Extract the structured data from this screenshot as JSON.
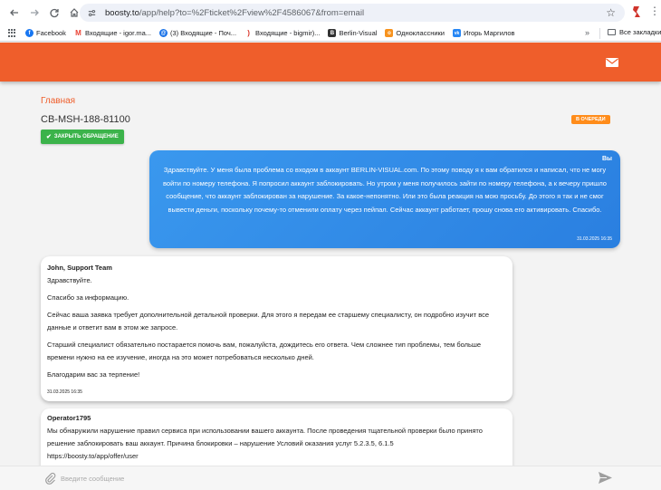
{
  "browser": {
    "url_host": "boosty.to",
    "url_path": "/app/help?to=%2Fticket%2Fview%2F4586067&from=email"
  },
  "bookmarks": {
    "items": [
      {
        "label": "Facebook",
        "color": "#1877f2",
        "glyph": "f"
      },
      {
        "label": "Входящие - igor.ma...",
        "color": "#ea4335",
        "glyph": "M"
      },
      {
        "label": "(3) Входящие - Поч...",
        "color": "#1a73e8",
        "glyph": "@"
      },
      {
        "label": "Входящие - bigmir)...",
        "color": "#d93025",
        "glyph": ")"
      },
      {
        "label": "Berlin-Visual",
        "color": "#333333",
        "glyph": "B"
      },
      {
        "label": "Одноклассники",
        "color": "#f7931e",
        "glyph": "ok"
      },
      {
        "label": "Игорь Маргилов",
        "color": "#2787f5",
        "glyph": "vk"
      }
    ],
    "more": "»",
    "all_label": "Все закладки"
  },
  "page": {
    "home_link": "Главная",
    "ticket_id": "CB-MSH-188-81100",
    "status_badge": "В ОЧЕРЕДИ",
    "close_button": "ЗАКРЫТЬ ОБРАЩЕНИЕ",
    "accent": "#ef5e2b"
  },
  "messages": {
    "user": {
      "author": "Вы",
      "text": "Здравствуйте. У меня была проблема со входом в аккаунт BERLIN-VISUAL.com. По этому поводу я к вам обратился и написал, что не могу войти по номеру телефона. Я попросил аккаунт заблокировать. Но утром у меня получилось зайти по номеру телефона, а к вечеру пришло сообщение, что аккаунт заблокирован за нарушение. За какое-непонятно. Или это была реакция на мою просьбу. До этого я так и не смог вывести деньги, поскольку почему-то отменили оплату через пейпал. Сейчас аккаунт работает, прошу снова его активировать. Спасибо.",
      "time": "31.03.2025 16:35"
    },
    "support": {
      "author": "John, Support Team",
      "greeting": "Здравствуйте.",
      "p1": "Спасибо за информацию.",
      "p2": "Сейчас ваша заявка требует дополнительной детальной проверки. Для этого я передам ее старшему специалисту, он подробно изучит все данные и ответит вам в этом же запросе.",
      "p3": "Старший специалист обязательно постарается помочь вам, пожалуйста, дождитесь его ответа. Чем сложнее тип проблемы, тем больше времени нужно на ее изучение, иногда на это может потребоваться несколько дней.",
      "p4": "Благодарим вас за терпение!",
      "time": "31.03.2025 16:35"
    },
    "operator": {
      "author": "Operator1795",
      "text": "Мы обнаружили нарушение правил сервиса при использовании вашего аккаунта. После проведения тщательной проверки было принято решение заблокировать ваш аккаунт. Причина блокировки – нарушение Условий оказания услуг 5.2.3.5, 6.1.5",
      "link": "https://boosty.to/app/offer/user"
    }
  },
  "composer": {
    "placeholder": "Введите сообщение"
  }
}
